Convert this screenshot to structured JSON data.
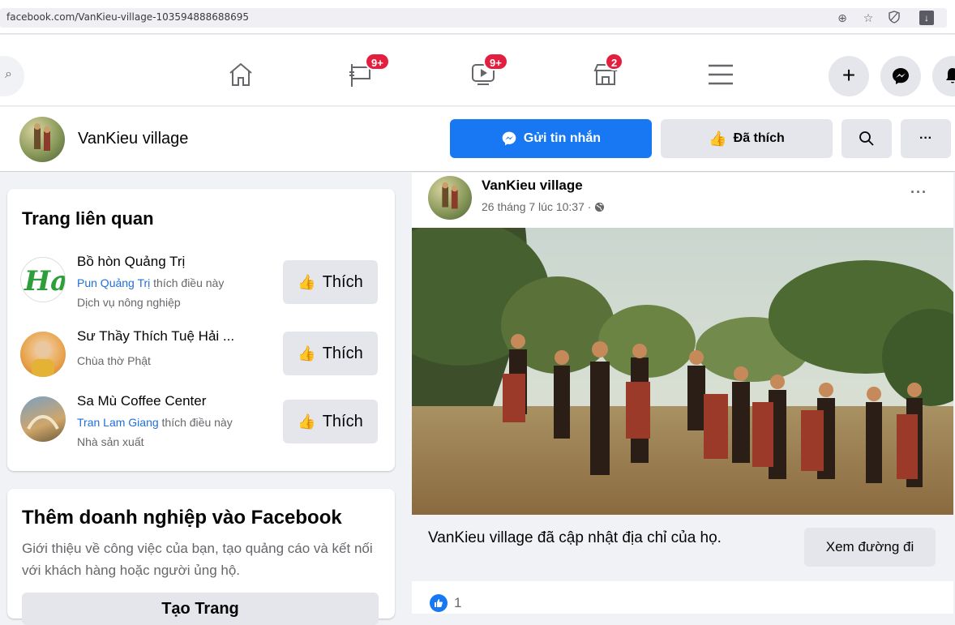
{
  "browser": {
    "url": "facebook.com/VanKieu-village-103594888688695",
    "icons": [
      "zoom-icon",
      "star-icon",
      "shield-icon",
      "download-icon"
    ]
  },
  "topnav": {
    "tabs": [
      {
        "name": "home-icon",
        "badge": ""
      },
      {
        "name": "flag-icon",
        "badge": "9+"
      },
      {
        "name": "watch-icon",
        "badge": "9+"
      },
      {
        "name": "marketplace-icon",
        "badge": "2"
      },
      {
        "name": "menu-icon",
        "badge": ""
      }
    ],
    "create": "+"
  },
  "page_header": {
    "name": "VanKieu village",
    "message_label": "Gửi tin nhắn",
    "liked_label": "Đã thích",
    "more": "···"
  },
  "related": {
    "title": "Trang liên quan",
    "like_label": "Thích",
    "items": [
      {
        "name": "Bồ hòn Quảng Trị",
        "liker": "Pun Quảng Trị",
        "liker_suffix": " thích điều này",
        "category": "Dịch vụ nông nghiệp"
      },
      {
        "name": "Sư Thầy Thích Tuệ Hải ...",
        "liker": "",
        "liker_suffix": "",
        "category": "Chùa thờ Phật"
      },
      {
        "name": "Sa Mù Coffee Center",
        "liker": "Tran Lam Giang",
        "liker_suffix": " thích điều này",
        "category": "Nhà sản xuất"
      }
    ]
  },
  "business": {
    "title": "Thêm doanh nghiệp vào Facebook",
    "description": "Giới thiệu về công việc của bạn, tạo quảng cáo và kết nối với khách hàng hoặc người ủng hộ.",
    "button": "Tạo Trang"
  },
  "post": {
    "author": "VanKieu village",
    "time": "26 tháng 7 lúc 10:37 ·",
    "privacy_icon": "globe-icon",
    "more": "···",
    "caption": "VanKieu village đã cập nhật địa chỉ của họ.",
    "directions_button": "Xem đường đi",
    "reaction_count": "1"
  },
  "colors": {
    "accent": "#1877f2",
    "badge": "#e41e3f",
    "background": "#f0f2f5",
    "secondary_text": "#65676b"
  }
}
